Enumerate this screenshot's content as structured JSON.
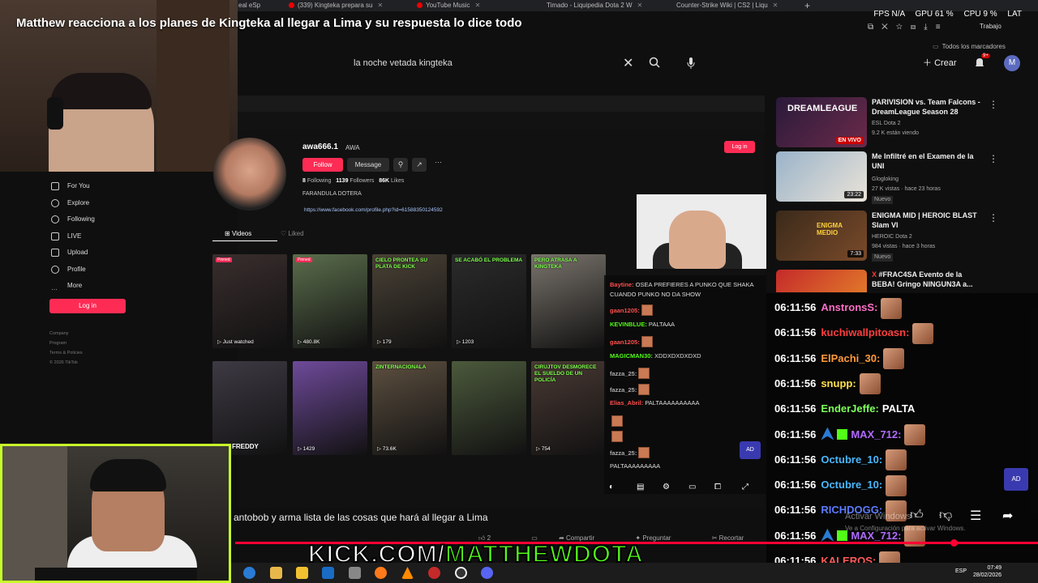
{
  "stream_title": "Matthew reacciona a los planes de Kingteka al llegar a Lima y su respuesta lo dice todo",
  "browser": {
    "tabs": [
      {
        "label": "eal eSp"
      },
      {
        "label": "(339) Kingteka prepara su"
      },
      {
        "label": "YouTube Music"
      },
      {
        "label": "Timado - Liquipedia Dota 2 W"
      },
      {
        "label": "Counter-Strike Wiki | CS2 | Liqu"
      }
    ],
    "stats": {
      "fps": "FPS N/A",
      "gpu": "GPU 61 %",
      "cpu": "CPU 9 %",
      "lat": "LAT"
    },
    "profile_label": "Trabajo",
    "bookmarks_label": "Todos los marcadores"
  },
  "youtube": {
    "search_value": "la noche vetada kingteka",
    "crear_label": "Crear",
    "avatar_letter": "M",
    "notif_count": "9+",
    "video_title": "antobob y arma lista de las cosas que hará al llegar a Lima",
    "actions": {
      "likes": "2",
      "share": "Compartir",
      "ask": "Preguntar",
      "clip": "Recortar"
    },
    "recommendations": [
      {
        "title": "PARIVISION vs. Team Falcons - DreamLeague Season 28",
        "channel": "ESL Dota 2",
        "meta": "9.2 K están viendo",
        "badge": "EN VIVO",
        "thumb_text": "DREAMLEAGUE"
      },
      {
        "title": "Me Infiltré en el Examen de la UNI",
        "channel": "Glogloking",
        "meta": "27 K vistas · hace 23 horas",
        "tag": "Nuevo",
        "duration": "23:22"
      },
      {
        "title": "ENIGMA MID | HEROIC BLAST Slam VI",
        "channel": "HEROIC Dota 2",
        "meta": "984 vistas · hace 3 horas",
        "tag": "Nuevo",
        "duration": "7:33",
        "thumb_text": "ENIGMA MEDIO"
      },
      {
        "title": "#FRAC4SA Evento de la BEBA! Gringo NINGUN3A a...",
        "thumb_text": "X"
      }
    ],
    "windows_watermark": "Activar Windows",
    "windows_watermark_sub": "Ve a Configuración para activar Windows."
  },
  "tiktok": {
    "nav": [
      "For You",
      "Explore",
      "Following",
      "LIVE",
      "Upload",
      "Profile",
      "More"
    ],
    "login_label": "Log in",
    "footer": [
      "Company",
      "Program",
      "Terms & Policies",
      "© 2026 TikTok"
    ],
    "username": "awa666.1",
    "nickname": "AWA",
    "follow_label": "Follow",
    "message_label": "Message",
    "stats": {
      "following": "8",
      "followers": "1139",
      "likes": "86K"
    },
    "stats_labels": {
      "following": "Following",
      "followers": "Followers",
      "likes": "Likes"
    },
    "bio": "FARANDULA DOTERA",
    "link": "https://www.facebook.com/profile.php?id=61588350124592",
    "tab_videos": "Videos",
    "tab_liked": "Liked",
    "top_login": "Log in",
    "videos": [
      {
        "views": "Just watched",
        "pinned": "Pinned",
        "color": "#3a2e2e"
      },
      {
        "views": "480.8K",
        "pinned": "Pinned",
        "caption": "",
        "color": "#5b6e4c"
      },
      {
        "views": "179",
        "caption": "CIELO PRONTEA SU PLATA DE KICK",
        "color": "#4a4236"
      },
      {
        "views": "1203",
        "caption": "SE ACABÓ EL PROBLEMA",
        "color": "#2b2b2b"
      },
      {
        "views": "",
        "caption": "PERO ATRASA A KINGTEKA",
        "color": "#7a746c"
      },
      {
        "views": "",
        "caption": "",
        "color": "#3e3a44"
      },
      {
        "views": "1429",
        "caption": "",
        "color": "#6e4a9a"
      },
      {
        "views": "73.6K",
        "caption": "ZINTERNACIONALA",
        "color": "#5d5040"
      },
      {
        "views": "",
        "caption": "",
        "color": "#4c5a3c"
      },
      {
        "views": "754",
        "caption": "CIRUJTOV DESMORECE EL SUELDO DE UN POLICÍA",
        "color": "#4a3a34"
      }
    ],
    "row2_label": "FREDDY"
  },
  "inner_chat": [
    {
      "user": "Baytine:",
      "msg": "OSEA PREFIERES A PUNKO QUE SHAKA CUANDO PUNKO NO DA SHOW",
      "color": "#ff4d4d"
    },
    {
      "user": "gaan1205:",
      "msg": "",
      "color": "#ff4d4d"
    },
    {
      "user": "KEVINBLUE:",
      "msg": "PALTAAA",
      "color": "#53fc18"
    },
    {
      "user": "gaan1205:",
      "msg": "",
      "color": "#ff4d4d"
    },
    {
      "user": "MAGICMAN30:",
      "msg": "XDDXDXDXDXD",
      "color": "#53fc18"
    },
    {
      "user": "fazza_25:",
      "msg": "",
      "color": "#aaa"
    },
    {
      "user": "fazza_25:",
      "msg": "",
      "color": "#aaa"
    },
    {
      "user": "Elias_Abril:",
      "msg": "PALTAAAAAAAAAA",
      "color": "#ff4d4d"
    },
    {
      "user": "",
      "msg": "",
      "color": "#ff4d4d"
    },
    {
      "user": "",
      "msg": "",
      "color": "#ff4d4d"
    },
    {
      "user": "fazza_25:",
      "msg": "",
      "color": "#aaa"
    },
    {
      "user": "",
      "msg": "PALTAAAAAAAAA",
      "color": "#aaa"
    }
  ],
  "chat": [
    {
      "time": "06:11:56",
      "user": "AnstronsS:",
      "color": "#ff6ec7",
      "msg": "",
      "emote": true
    },
    {
      "time": "06:11:56",
      "user": "kuchiwallpitoasn:",
      "color": "#ff3e3e",
      "msg": "",
      "emote": true
    },
    {
      "time": "06:11:56",
      "user": "ElPachi_30:",
      "color": "#ff9a3c",
      "msg": "",
      "emote": true
    },
    {
      "time": "06:11:56",
      "user": "snupp:",
      "color": "#ffe14d",
      "msg": "",
      "emote": true
    },
    {
      "time": "06:11:56",
      "user": "EnderJeffe:",
      "color": "#7dff5a",
      "msg": "PALTA",
      "emote": false
    },
    {
      "time": "06:11:56",
      "user": "MAX_712:",
      "color": "#b06bff",
      "msg": "",
      "emote": true,
      "badges": true
    },
    {
      "time": "06:11:56",
      "user": "Octubre_10:",
      "color": "#49b7ff",
      "msg": "",
      "emote": true
    },
    {
      "time": "06:11:56",
      "user": "Octubre_10:",
      "color": "#49b7ff",
      "msg": "",
      "emote": true
    },
    {
      "time": "06:11:56",
      "user": "RICHDOGG:",
      "color": "#5a7bff",
      "msg": "",
      "emote": true
    },
    {
      "time": "06:11:56",
      "user": "MAX_712:",
      "color": "#b06bff",
      "msg": "",
      "emote": true,
      "badges": true
    },
    {
      "time": "06:11:56",
      "user": "KALEROS:",
      "color": "#ff5a5a",
      "msg": "",
      "emote": true
    }
  ],
  "overlay": {
    "kick_prefix": "KICK.COM/",
    "kick_name": "MATTHEWDOTA"
  },
  "taskbar": {
    "lang": "ESP",
    "time": "07:49",
    "date": "28/02/2026"
  },
  "colors": {
    "kick_green": "#53fc18",
    "tiktok_red": "#fe2c55",
    "yt_red": "#ff0033",
    "cam_border": "#c8ff2a"
  }
}
